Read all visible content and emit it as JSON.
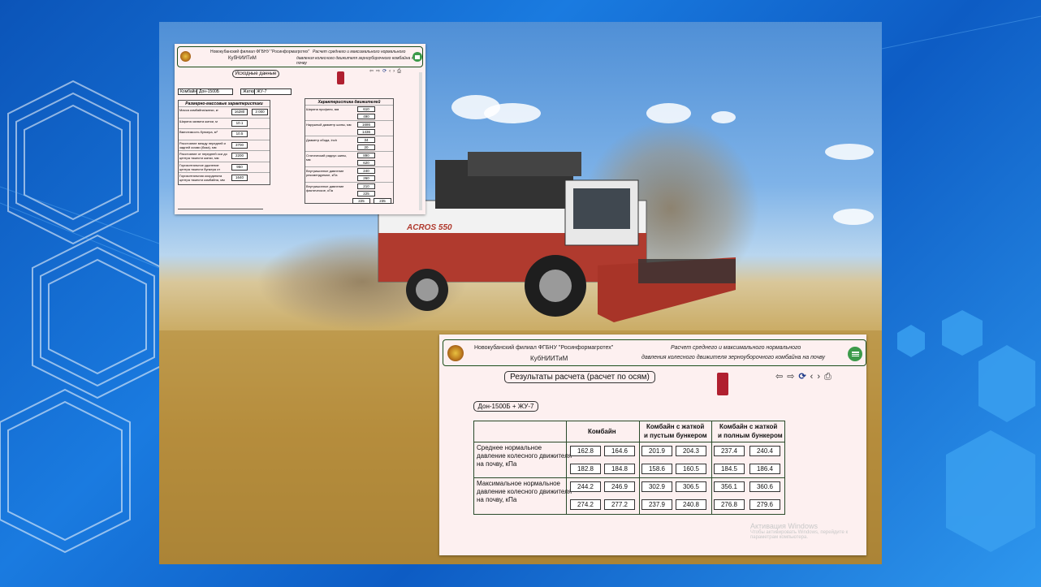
{
  "app": {
    "org_line1": "Новокубанский филиал  ФГБНУ  \"Росинформагротех\"",
    "org_line2": "КубНИИТиМ",
    "title_line1": "Расчет среднего и максимального нормального",
    "title_line2": "давления колесного движителя зернouборочного комбайна на почву"
  },
  "small_window": {
    "org_line1": "Новокубанский филиал  ФГБНУ  \"Росинформагротех\"",
    "org_line2": "КубНИИТиМ",
    "title_line1": "Расчет среднего и максимального нормального",
    "title_line2": "давления колесного движителя зерноуборочного комбайна на почву",
    "section_button": "Исходные данные",
    "combine_label": "Комбайн",
    "combine_value": "Дон-1500Б",
    "header_label": "Жатка",
    "header_value": "ЖУ-7",
    "mass_panel": {
      "title": "Размерно-массовые характеристики",
      "rows": [
        {
          "label": "Масса комбайна/жатки, кг",
          "v1": "16280",
          "v2": "3 000"
        },
        {
          "label": "Ширина захвата жатки, м",
          "v1": "10.1",
          "v2": ""
        },
        {
          "label": "Вместимость бункера, м³",
          "v1": "10.5",
          "v2": ""
        },
        {
          "label": "Расстояние между передней и задней осями (база), мм",
          "v1": "3700",
          "v2": ""
        },
        {
          "label": "Расстояние от передней оси до центра тяжести жатки, мм",
          "v1": "2200",
          "v2": ""
        },
        {
          "label": "Горизонтальное удаление центра тяжести бункера от передней оси, мм",
          "v1": "950",
          "v2": ""
        },
        {
          "label": "Горизонтальная координата центра тяжести комбайна, мм",
          "v1": "1640",
          "v2": ""
        }
      ]
    },
    "mover_panel": {
      "title": "Характеристика движителей",
      "rows": [
        {
          "label": "Ширина профиля, мм",
          "v1": "610",
          "v2": "490"
        },
        {
          "label": "Наружный диаметр шины, мм",
          "v1": "1686",
          "v2": "1436"
        },
        {
          "label": "Диаметр обода, inch",
          "v1": "34",
          "v2": "20"
        },
        {
          "label": "Статический радиус шины, мм",
          "v1": "890",
          "v2": "620"
        },
        {
          "label": "Внутришинное давление рекомендуемое, кПа",
          "v1": "240",
          "v2": "260"
        },
        {
          "label": "Внутришинное давление фактическое, кПа",
          "v1": "210",
          "v2": "225"
        }
      ],
      "extra_values": [
        "225",
        "235"
      ]
    }
  },
  "large_window": {
    "org_line1": "Новокубанский филиал  ФГБНУ  \"Росинформагротех\"",
    "org_line2": "КубНИИТиМ",
    "title_line1": "Расчет среднего и максимального нормального",
    "title_line2": "давления колесного движителя зерноуборочного комбайна на почву",
    "section_button": "Результаты расчета (расчет по осям)",
    "config_label": "Дон-1500Б + ЖУ-7",
    "columns": [
      {
        "line1": "Комбайн",
        "line2": ""
      },
      {
        "line1": "Комбайн с жаткой",
        "line2": "и пустым бункером"
      },
      {
        "line1": "Комбайн с жаткой",
        "line2": "и полным бункером"
      }
    ],
    "rows": [
      {
        "label_lines": [
          "Среднее нормальное",
          "давление колесного движителя",
          "на почву, кПа"
        ],
        "values_a": [
          "162.8",
          "164.6",
          "201.9",
          "204.3",
          "237.4",
          "240.4"
        ],
        "values_b": [
          "182.8",
          "184.8",
          "158.6",
          "160.5",
          "184.5",
          "186.4"
        ]
      },
      {
        "label_lines": [
          "Максимальное нормальное",
          "давление колесного движителя",
          "на почву, кПа"
        ],
        "values_a": [
          "244.2",
          "246.9",
          "302.9",
          "306.5",
          "356.1",
          "360.6"
        ],
        "values_b": [
          "274.2",
          "277.2",
          "237.9",
          "240.8",
          "276.8",
          "279.6"
        ]
      }
    ]
  },
  "photo": {
    "combine_brand": "ACROS 550"
  },
  "watermark": {
    "line1": "Активация Windows",
    "line2": "Чтобы активировать Windows, перейдите к",
    "line3": "параметрам компьютера."
  },
  "nav_icons": [
    "back-arrow-icon",
    "forward-arrow-icon",
    "refresh-icon",
    "code-icon",
    "print-icon"
  ],
  "colors": {
    "window_bg": "#fdf0f0",
    "border_green": "#1b4d1b",
    "menu_green": "#3c9a4a",
    "desktop_blue": "#0b54b8"
  }
}
